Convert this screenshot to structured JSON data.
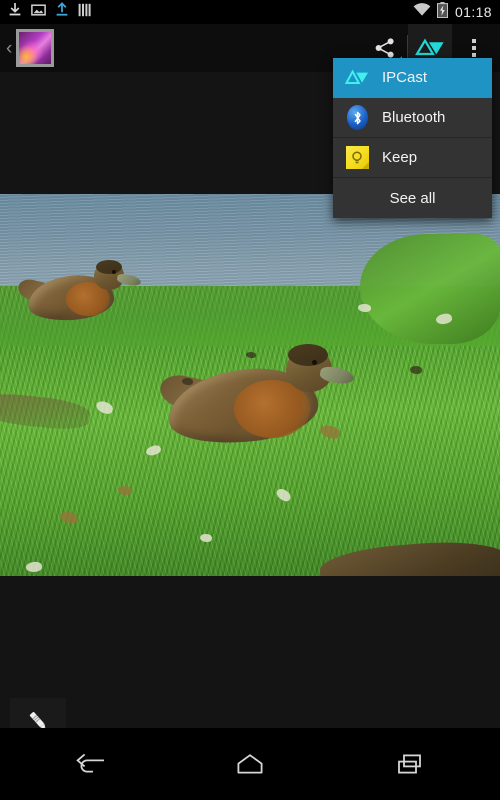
{
  "status_bar": {
    "clock": "01:18",
    "left_icons": [
      {
        "name": "download-icon",
        "label": "Download"
      },
      {
        "name": "screenshot-icon",
        "label": "Screenshot captured"
      },
      {
        "name": "upload-icon",
        "label": "Upload"
      },
      {
        "name": "bars-icon",
        "label": "Equalizer"
      }
    ],
    "right_icons": [
      {
        "name": "wifi-icon",
        "label": "Wi-Fi connected"
      },
      {
        "name": "battery-charging-icon",
        "label": "Battery charging"
      }
    ]
  },
  "action_bar": {
    "up_chevron": "‹",
    "app_icon_label": "Gallery",
    "buttons": [
      {
        "name": "share-button",
        "label": "Share",
        "has_dropdown": true
      },
      {
        "name": "cast-button",
        "label": "IPCast",
        "has_dropdown": false
      },
      {
        "name": "overflow-button",
        "label": "More options",
        "has_dropdown": false
      }
    ]
  },
  "share_menu": {
    "items": [
      {
        "label": "IPCast",
        "icon": "cast-icon",
        "selected": true
      },
      {
        "label": "Bluetooth",
        "icon": "bluetooth-icon",
        "selected": false
      },
      {
        "label": "Keep",
        "icon": "keep-icon",
        "selected": false
      },
      {
        "label": "See all",
        "icon": "",
        "selected": false
      }
    ]
  },
  "content": {
    "photo_alt": "Two mallard ducks resting on green grass beside a lake",
    "edit_button_label": "Edit"
  },
  "nav_bar": {
    "buttons": [
      {
        "name": "nav-back-button",
        "label": "Back"
      },
      {
        "name": "nav-home-button",
        "label": "Home"
      },
      {
        "name": "nav-recents-button",
        "label": "Recent apps"
      }
    ]
  },
  "colors": {
    "accent": "#1f93c4",
    "cast_cyan": "#21d9d9",
    "menu_bg": "#333333",
    "keep_yellow": "#f5dc1e",
    "bluetooth_blue": "#1a5fc4"
  }
}
